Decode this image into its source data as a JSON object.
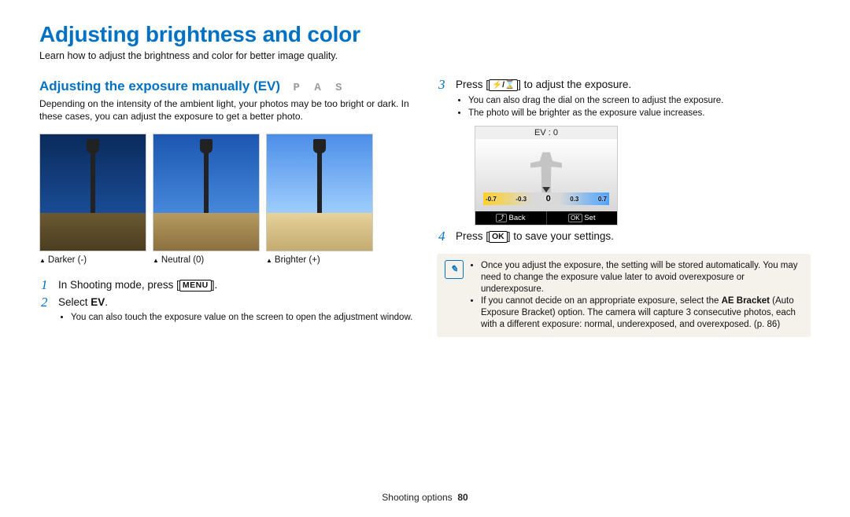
{
  "page_title": "Adjusting brightness and color",
  "subtitle": "Learn how to adjust the brightness and color for better image quality.",
  "section": {
    "heading": "Adjusting the exposure manually (EV)",
    "modes": "P A S",
    "body": "Depending on the intensity of the ambient light, your photos may be too bright or dark. In these cases, you can adjust the exposure to get a better photo."
  },
  "examples": [
    {
      "caption": "Darker (-)"
    },
    {
      "caption": "Neutral (0)"
    },
    {
      "caption": "Brighter (+)"
    }
  ],
  "steps_left": {
    "s1_a": "In Shooting mode, press [",
    "s1_btn": "MENU",
    "s1_b": "].",
    "s2_a": "Select ",
    "s2_bold": "EV",
    "s2_b": ".",
    "s2_sub": "You can also touch the exposure value on the screen to open the adjustment window."
  },
  "steps_right": {
    "s3_a": "Press [",
    "s3_icons": "⚡/⌛",
    "s3_b": "] to adjust the exposure.",
    "s3_sub1": "You can also drag the dial on the screen to adjust the exposure.",
    "s3_sub2": "The photo will be brighter as the exposure value increases.",
    "s4_a": "Press [",
    "s4_btn": "OK",
    "s4_b": "] to save your settings."
  },
  "camera_preview": {
    "header": "EV : 0",
    "scale": [
      "-0.7",
      "-0.3",
      "0",
      "0.3",
      "0.7"
    ],
    "back_key": "⤴",
    "back_label": "Back",
    "ok_key": "OK",
    "ok_label": "Set"
  },
  "note": {
    "n1_a": "Once you adjust the exposure, the setting will be stored automatically. You may need to change the exposure value later to avoid overexposure or underexposure.",
    "n2_a": "If you cannot decide on an appropriate exposure, select the ",
    "n2_bold": "AE Bracket",
    "n2_b": " (Auto Exposure Bracket) option. The camera will capture 3 consecutive photos, each with a different exposure: normal, underexposed, and overexposed. (p. 86)"
  },
  "footer": {
    "section": "Shooting options",
    "page": "80"
  }
}
